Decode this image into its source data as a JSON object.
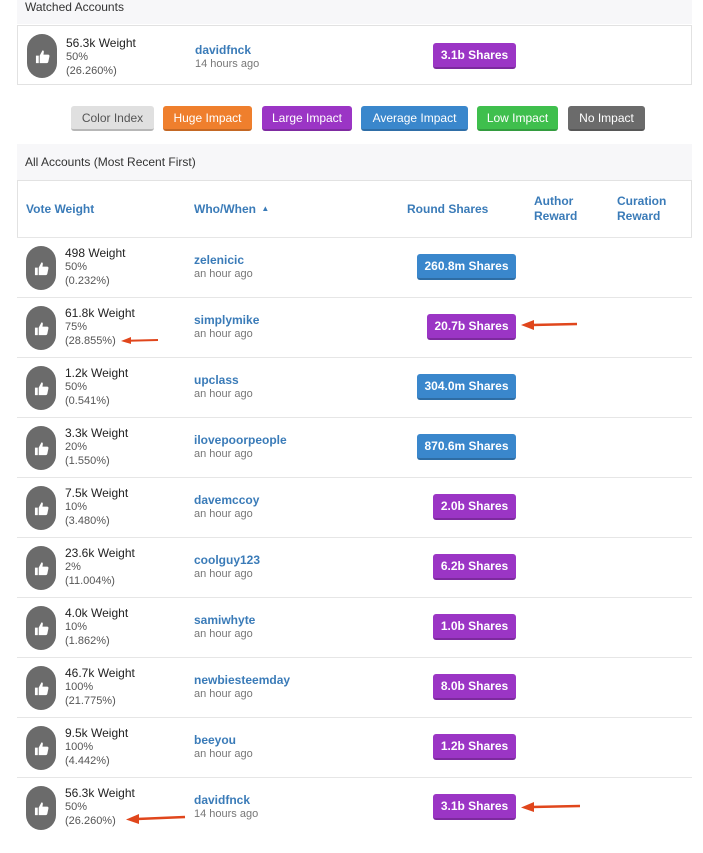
{
  "watched": {
    "title": "Watched Accounts",
    "row": {
      "weight": "56.3k Weight",
      "percent": "50%",
      "share": "(26.260%)",
      "name": "davidfnck",
      "when": "14 hours ago",
      "shares": "3.1b Shares",
      "impact": "large"
    }
  },
  "legend": [
    {
      "label": "Color Index",
      "color": "#e0e0e0",
      "text_color": "#555555"
    },
    {
      "label": "Huge Impact",
      "color": "#ef7f2d",
      "text_color": "#ffffff"
    },
    {
      "label": "Large Impact",
      "color": "#9b35c5",
      "text_color": "#ffffff"
    },
    {
      "label": "Average Impact",
      "color": "#3a87cc",
      "text_color": "#ffffff"
    },
    {
      "label": "Low Impact",
      "color": "#3fbf4d",
      "text_color": "#ffffff"
    },
    {
      "label": "No Impact",
      "color": "#6b6b6b",
      "text_color": "#ffffff"
    }
  ],
  "all": {
    "title": "All Accounts (Most Recent First)",
    "columns": {
      "vote_weight": "Vote Weight",
      "who_when": "Who/When",
      "sort_indicator": "▲",
      "round_shares": "Round Shares",
      "author_reward_1": "Author",
      "author_reward_2": "Reward",
      "curation_reward_1": "Curation",
      "curation_reward_2": "Reward"
    },
    "rows": [
      {
        "weight": "498 Weight",
        "percent": "50%",
        "share": "(0.232%)",
        "name": "zelenicic",
        "when": "an hour ago",
        "shares": "260.8m Shares",
        "impact": "average"
      },
      {
        "weight": "61.8k Weight",
        "percent": "75%",
        "share": "(28.855%)",
        "name": "simplymike",
        "when": "an hour ago",
        "shares": "20.7b Shares",
        "impact": "large"
      },
      {
        "weight": "1.2k Weight",
        "percent": "50%",
        "share": "(0.541%)",
        "name": "upclass",
        "when": "an hour ago",
        "shares": "304.0m Shares",
        "impact": "average"
      },
      {
        "weight": "3.3k Weight",
        "percent": "20%",
        "share": "(1.550%)",
        "name": "ilovepoorpeople",
        "when": "an hour ago",
        "shares": "870.6m Shares",
        "impact": "average"
      },
      {
        "weight": "7.5k Weight",
        "percent": "10%",
        "share": "(3.480%)",
        "name": "davemccoy",
        "when": "an hour ago",
        "shares": "2.0b Shares",
        "impact": "large"
      },
      {
        "weight": "23.6k Weight",
        "percent": "2%",
        "share": "(11.004%)",
        "name": "coolguy123",
        "when": "an hour ago",
        "shares": "6.2b Shares",
        "impact": "large"
      },
      {
        "weight": "4.0k Weight",
        "percent": "10%",
        "share": "(1.862%)",
        "name": "samiwhyte",
        "when": "an hour ago",
        "shares": "1.0b Shares",
        "impact": "large"
      },
      {
        "weight": "46.7k Weight",
        "percent": "100%",
        "share": "(21.775%)",
        "name": "newbiesteemday",
        "when": "an hour ago",
        "shares": "8.0b Shares",
        "impact": "large"
      },
      {
        "weight": "9.5k Weight",
        "percent": "100%",
        "share": "(4.442%)",
        "name": "beeyou",
        "when": "an hour ago",
        "shares": "1.2b Shares",
        "impact": "large"
      },
      {
        "weight": "56.3k Weight",
        "percent": "50%",
        "share": "(26.260%)",
        "name": "davidfnck",
        "when": "14 hours ago",
        "shares": "3.1b Shares",
        "impact": "large"
      }
    ]
  },
  "impact_colors": {
    "large": "#9b35c5",
    "average": "#3a87cc",
    "huge": "#ef7f2d",
    "low": "#3fbf4d",
    "none": "#6b6b6b"
  },
  "icons": {
    "vote": "thumbs-up-icon",
    "annotation": "red-arrow-icon"
  }
}
